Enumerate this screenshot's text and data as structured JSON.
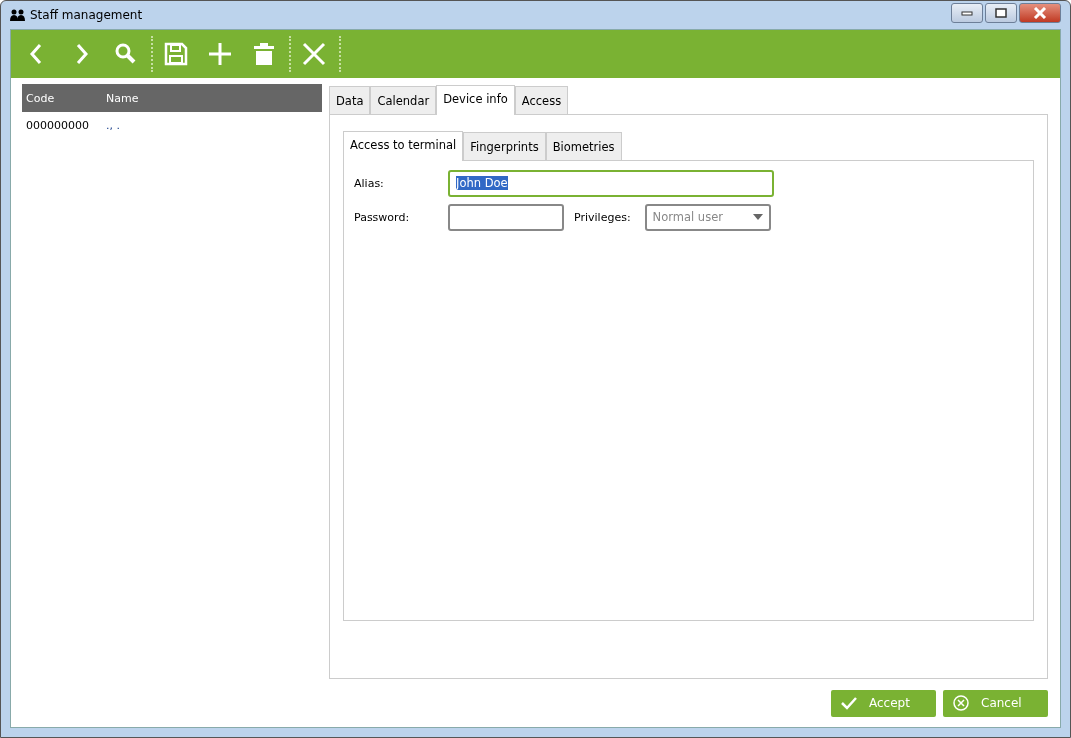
{
  "window": {
    "title": "Staff management"
  },
  "toolbar": {
    "groups": [
      [
        {
          "kind": "back"
        },
        {
          "kind": "forward"
        },
        {
          "kind": "search"
        }
      ],
      [
        {
          "kind": "save"
        },
        {
          "kind": "add"
        },
        {
          "kind": "delete"
        }
      ],
      [
        {
          "kind": "close"
        }
      ]
    ]
  },
  "staff_list": {
    "columns": [
      "Code",
      "Name"
    ],
    "rows": [
      {
        "code": "000000000",
        "name": "., ."
      }
    ]
  },
  "tabs": [
    {
      "label": "Data",
      "selected": false
    },
    {
      "label": "Calendar",
      "selected": false
    },
    {
      "label": "Device info",
      "selected": true
    },
    {
      "label": "Access",
      "selected": false
    }
  ],
  "sub_tabs": [
    {
      "label": "Access to terminal",
      "selected": true
    },
    {
      "label": "Fingerprints",
      "selected": false
    },
    {
      "label": "Biometries",
      "selected": false
    }
  ],
  "form": {
    "alias": {
      "label": "Alias:",
      "value": "John Doe",
      "focused": true
    },
    "password": {
      "label": "Password:",
      "focused": false
    },
    "privileges": {
      "label": "Privileges:",
      "value": "Normal user"
    }
  },
  "buttons": [
    {
      "kind": "accept",
      "label": "Accept"
    },
    {
      "kind": "cancel",
      "label": "Cancel"
    }
  ]
}
